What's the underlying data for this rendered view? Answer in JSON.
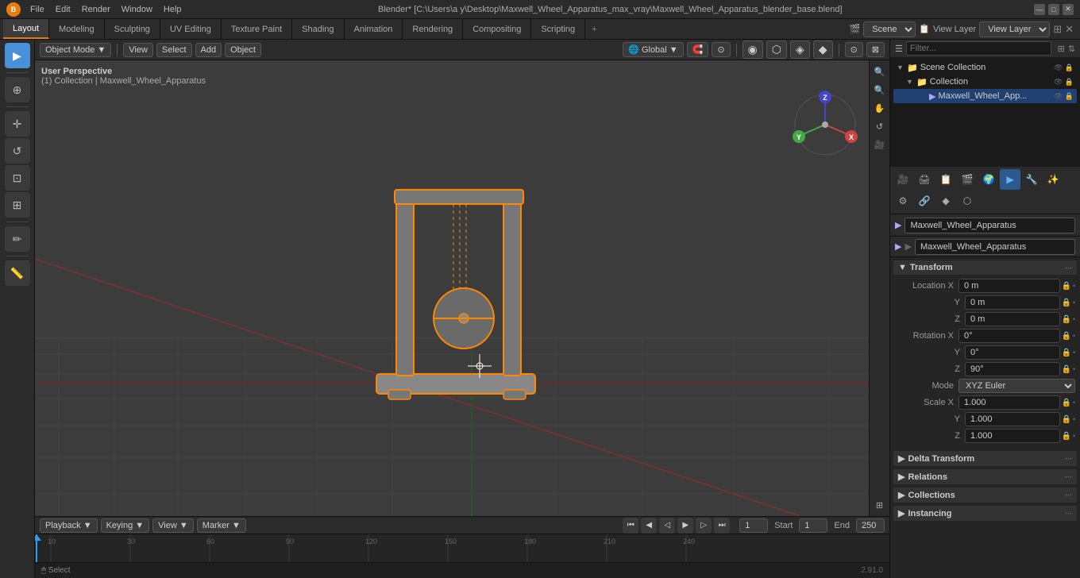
{
  "titlebar": {
    "logo": "B",
    "menus": [
      "File",
      "Edit",
      "Render",
      "Window",
      "Help"
    ],
    "title": "Blender* [C:\\Users\\a y\\Desktop\\Maxwell_Wheel_Apparatus_max_vray\\Maxwell_Wheel_Apparatus_blender_base.blend]",
    "controls": [
      "—",
      "□",
      "✕"
    ]
  },
  "workspace_tabs": {
    "tabs": [
      "Layout",
      "Modeling",
      "Sculpting",
      "UV Editing",
      "Texture Paint",
      "Shading",
      "Animation",
      "Rendering",
      "Compositing",
      "Scripting"
    ],
    "active": "Layout",
    "plus": "+",
    "scene_label": "Scene",
    "scene_value": "Scene",
    "viewlayer_label": "View Layer",
    "viewlayer_value": "View Layer"
  },
  "viewport": {
    "mode": "Object Mode",
    "view_menu": "View",
    "select_menu": "Select",
    "add_menu": "Add",
    "object_menu": "Object",
    "info_line1": "User Perspective",
    "info_line2": "(1) Collection | Maxwell_Wheel_Apparatus",
    "transform": "Global",
    "snap_icon": "🧲",
    "proportional_icon": "⊙"
  },
  "tools": {
    "select": "▶",
    "move": "✛",
    "rotate": "↺",
    "scale": "⊡",
    "transform": "⊞",
    "annotate": "✏",
    "measure": "📏",
    "cursor": "⊕"
  },
  "outliner": {
    "search_placeholder": "Filter...",
    "scene_collection": "Scene Collection",
    "collection": "Collection",
    "object": "Maxwell_Wheel_App...",
    "filter_icon": "⊞",
    "sort_icon": "⇅"
  },
  "properties": {
    "object_name": "Maxwell_Wheel_Apparatus",
    "sections": {
      "transform": {
        "label": "Transform",
        "location": {
          "label": "Location",
          "x": "0 m",
          "y": "0 m",
          "z": "0 m"
        },
        "rotation": {
          "label": "Rotation",
          "x": "0°",
          "y": "0°",
          "z": "90°"
        },
        "mode": {
          "label": "Mode",
          "value": "XYZ Euler"
        },
        "scale": {
          "label": "Scale",
          "x": "1.000",
          "y": "1.000",
          "z": "1.000"
        }
      },
      "delta_transform": {
        "label": "Delta Transform",
        "collapsed": true
      },
      "relations": {
        "label": "Relations",
        "collapsed": true
      },
      "collections": {
        "label": "Collections",
        "collapsed": true
      },
      "instancing": {
        "label": "Instancing",
        "collapsed": true
      }
    }
  },
  "timeline": {
    "header_items": [
      "Playback",
      "Keying",
      "View",
      "Marker"
    ],
    "frame_current": "1",
    "frame_start_label": "Start",
    "frame_start": "1",
    "frame_end_label": "End",
    "frame_end": "250"
  },
  "statusbar": {
    "left": "🖱 Select",
    "right": "2.91.0",
    "mid": ""
  },
  "colors": {
    "accent": "#e87d0d",
    "active_tab_bg": "#3c3c3c",
    "selected_item": "#1f4070",
    "viewport_bg": "#3c3c3c",
    "grid_line": "#444",
    "grid_line_major": "#555",
    "object_outline": "#ff8800"
  }
}
